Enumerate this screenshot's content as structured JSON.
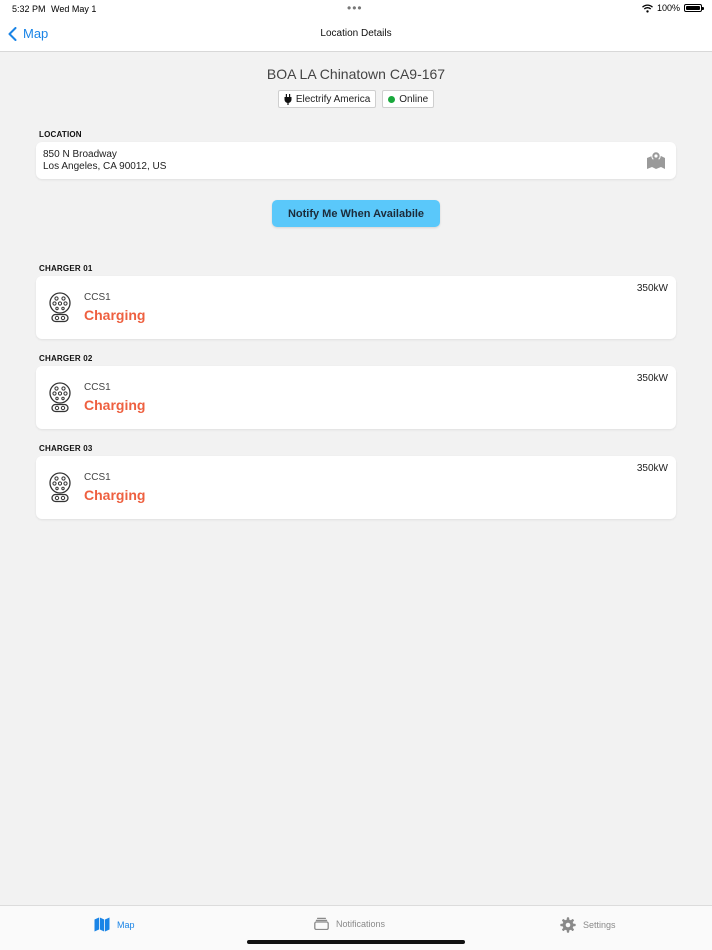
{
  "status_bar": {
    "time": "5:32 PM",
    "date": "Wed May 1",
    "battery": "100%"
  },
  "nav": {
    "back_label": "Map",
    "title": "Location Details"
  },
  "station": {
    "name": "BOA LA Chinatown CA9-167",
    "network": "Electrify America",
    "status": "Online",
    "status_color": "#19a83c"
  },
  "location": {
    "section_label": "LOCATION",
    "address_line1": "850 N Broadway",
    "address_line2": "Los Angeles, CA 90012, US"
  },
  "notify_button": "Notify Me When Availabile",
  "chargers": [
    {
      "label": "CHARGER 01",
      "connector": "CCS1",
      "status": "Charging",
      "power": "350kW"
    },
    {
      "label": "CHARGER 02",
      "connector": "CCS1",
      "status": "Charging",
      "power": "350kW"
    },
    {
      "label": "CHARGER 03",
      "connector": "CCS1",
      "status": "Charging",
      "power": "350kW"
    }
  ],
  "tabs": [
    {
      "label": "Map",
      "icon": "map-icon",
      "active": true
    },
    {
      "label": "Notifications",
      "icon": "tray-icon",
      "active": false
    },
    {
      "label": "Settings",
      "icon": "gear-icon",
      "active": false
    }
  ],
  "colors": {
    "accent": "#1a84e6",
    "charging": "#ee6040",
    "notify_button": "#5ac8fa"
  }
}
